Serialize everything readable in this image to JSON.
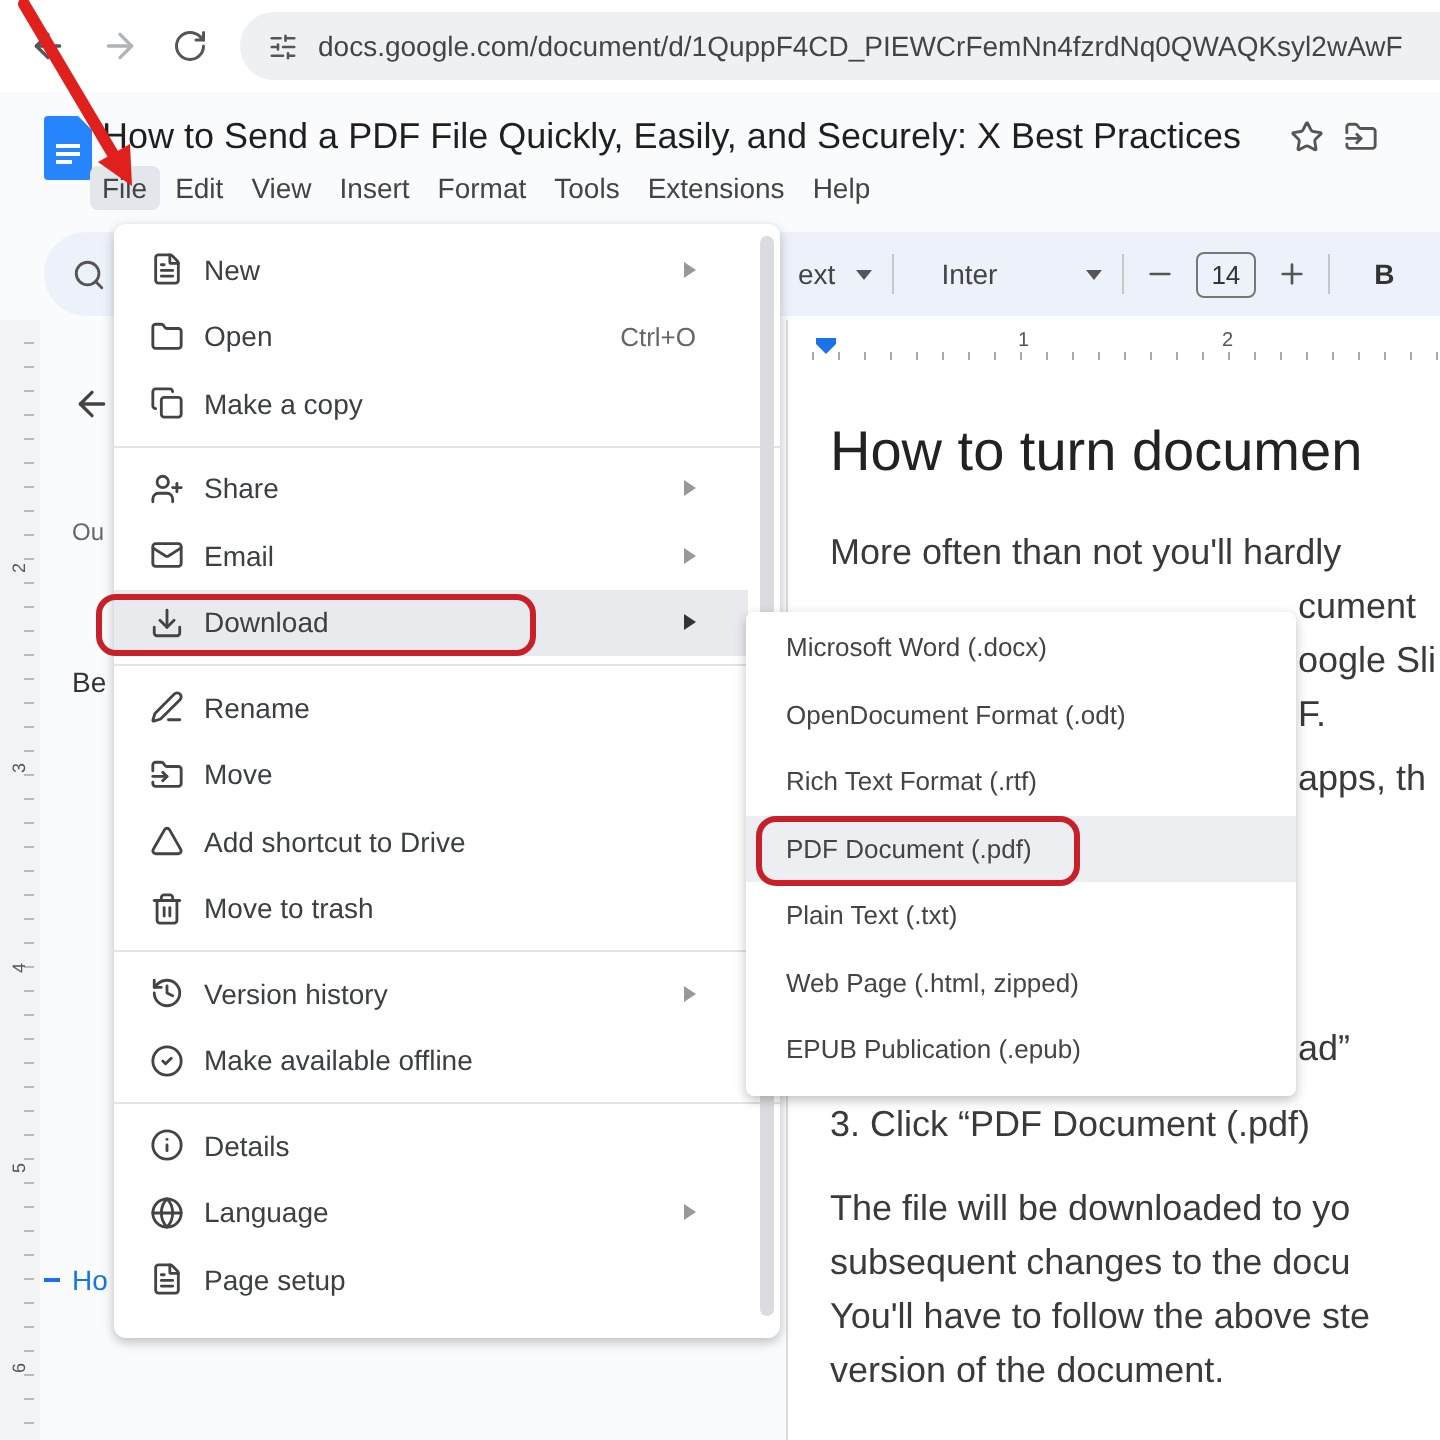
{
  "browser": {
    "url": "docs.google.com/document/d/1QuppF4CD_PIEWCrFemNn4fzrdNq0QWAQKsyl2wAwF"
  },
  "document": {
    "title": "How to Send a PDF File Quickly, Easily, and Securely: X Best Practices"
  },
  "menubar": [
    {
      "label": "File",
      "selected": true
    },
    {
      "label": "Edit",
      "selected": false
    },
    {
      "label": "View",
      "selected": false
    },
    {
      "label": "Insert",
      "selected": false
    },
    {
      "label": "Format",
      "selected": false
    },
    {
      "label": "Tools",
      "selected": false
    },
    {
      "label": "Extensions",
      "selected": false
    },
    {
      "label": "Help",
      "selected": false
    }
  ],
  "toolbar": {
    "style": "ext",
    "font": "Inter",
    "font_size": "14",
    "bold": "B"
  },
  "ruler": {
    "top_marks": [
      "1",
      "2"
    ],
    "side_marks": [
      "2",
      "3",
      "4",
      "5",
      "6"
    ]
  },
  "outline": {
    "label": "Ou",
    "items": [
      {
        "text": "Be",
        "selected": false
      },
      {
        "text": "Ho",
        "selected": true
      }
    ]
  },
  "file_menu": {
    "groups": [
      [
        {
          "label": "New",
          "submenu": true,
          "selected": false,
          "circled": false
        },
        {
          "label": "Open",
          "shortcut": "Ctrl+O",
          "submenu": false,
          "selected": false,
          "circled": false
        },
        {
          "label": "Make a copy",
          "submenu": false,
          "selected": false,
          "circled": false
        }
      ],
      [
        {
          "label": "Share",
          "submenu": true,
          "selected": false,
          "circled": false
        },
        {
          "label": "Email",
          "submenu": true,
          "selected": false,
          "circled": false
        },
        {
          "label": "Download",
          "submenu": true,
          "selected": true,
          "circled": true
        }
      ],
      [
        {
          "label": "Rename",
          "submenu": false,
          "selected": false,
          "circled": false
        },
        {
          "label": "Move",
          "submenu": false,
          "selected": false,
          "circled": false
        },
        {
          "label": "Add shortcut to Drive",
          "submenu": false,
          "selected": false,
          "circled": false
        },
        {
          "label": "Move to trash",
          "submenu": false,
          "selected": false,
          "circled": false
        }
      ],
      [
        {
          "label": "Version history",
          "submenu": true,
          "selected": false,
          "circled": false
        },
        {
          "label": "Make available offline",
          "submenu": false,
          "selected": false,
          "circled": false
        }
      ],
      [
        {
          "label": "Details",
          "submenu": false,
          "selected": false,
          "circled": false
        },
        {
          "label": "Language",
          "submenu": true,
          "selected": false,
          "circled": false
        },
        {
          "label": "Page setup",
          "submenu": false,
          "selected": false,
          "circled": false
        }
      ]
    ]
  },
  "download_menu": [
    {
      "label": "Microsoft Word (.docx)",
      "selected": false,
      "circled": false
    },
    {
      "label": "OpenDocument Format (.odt)",
      "selected": false,
      "circled": false
    },
    {
      "label": "Rich Text Format (.rtf)",
      "selected": false,
      "circled": false
    },
    {
      "label": "PDF Document (.pdf)",
      "selected": true,
      "circled": true
    },
    {
      "label": "Plain Text (.txt)",
      "selected": false,
      "circled": false
    },
    {
      "label": "Web Page (.html, zipped)",
      "selected": false,
      "circled": false
    },
    {
      "label": "EPUB Publication (.epub)",
      "selected": false,
      "circled": false
    }
  ],
  "page": {
    "heading": "How to turn documen",
    "paragraphs": [
      {
        "lines": [
          {
            "text": "More often than not you'll hardly",
            "kind": "full"
          },
          {
            "text": "cument",
            "kind": "tail"
          },
          {
            "text": "oogle Sli",
            "kind": "tail"
          },
          {
            "text": "F.",
            "kind": "tail"
          }
        ]
      },
      {
        "lines": [
          {
            "text": "apps, th",
            "kind": "tail"
          }
        ]
      },
      {
        "lines": [
          {
            "text": "ad”",
            "kind": "tail"
          }
        ]
      },
      {
        "lines": [
          {
            "text": "3. Click “PDF Document (.pdf)",
            "kind": "full"
          }
        ]
      },
      {
        "lines": [
          {
            "text": "The file will be downloaded to yo",
            "kind": "full"
          },
          {
            "text": "subsequent changes to the docu",
            "kind": "full"
          },
          {
            "text": "You'll have to follow the above ste",
            "kind": "full"
          },
          {
            "text": "version of the document.",
            "kind": "full"
          }
        ]
      }
    ]
  },
  "annotation": {
    "kind": "arrow"
  }
}
